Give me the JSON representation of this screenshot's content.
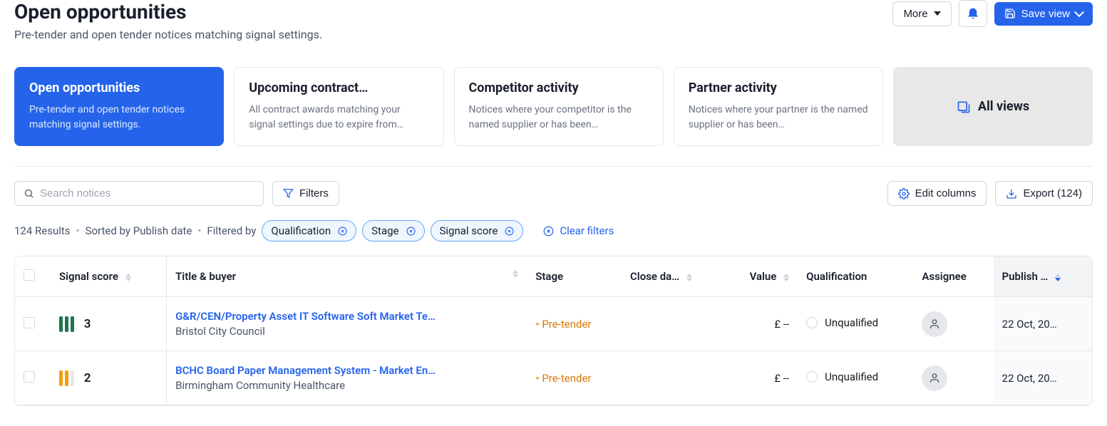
{
  "header": {
    "title": "Open opportunities",
    "subtitle": "Pre-tender and open tender notices matching signal settings.",
    "more_label": "More",
    "save_view_label": "Save view"
  },
  "views": [
    {
      "title": "Open opportunities",
      "description": "Pre-tender and open tender notices matching signal settings.",
      "active": true
    },
    {
      "title": "Upcoming contract…",
      "description": "All contract awards matching your signal settings due to expire from…",
      "active": false
    },
    {
      "title": "Competitor activity",
      "description": "Notices where your competitor is the named supplier or has been…",
      "active": false
    },
    {
      "title": "Partner activity",
      "description": "Notices where your partner is the named supplier or has been…",
      "active": false
    }
  ],
  "all_views_label": "All views",
  "toolbar": {
    "search_placeholder": "Search notices",
    "filters_label": "Filters",
    "edit_columns_label": "Edit columns",
    "export_label": "Export (124)"
  },
  "filters": {
    "results_text": "124 Results",
    "sorted_by_text": "Sorted by Publish date",
    "filtered_by_text": "Filtered by",
    "chips": [
      "Qualification",
      "Stage",
      "Signal score"
    ],
    "clear_label": "Clear filters"
  },
  "table": {
    "columns": {
      "signal_score": "Signal score",
      "title_buyer": "Title & buyer",
      "stage": "Stage",
      "close_date": "Close da…",
      "value": "Value",
      "qualification": "Qualification",
      "assignee": "Assignee",
      "publish": "Publish …"
    },
    "rows": [
      {
        "score": "3",
        "title": "G&R/CEN/Property Asset IT Software Soft Market Te…",
        "buyer": "Bristol City Council",
        "stage": "Pre-tender",
        "value": "£ --",
        "qualification": "Unqualified",
        "publish": "22 Oct, 20…"
      },
      {
        "score": "2",
        "title": "BCHC Board Paper Management System - Market En…",
        "buyer": "Birmingham Community Healthcare",
        "stage": "Pre-tender",
        "value": "£ --",
        "qualification": "Unqualified",
        "publish": "22 Oct, 20…"
      }
    ]
  }
}
